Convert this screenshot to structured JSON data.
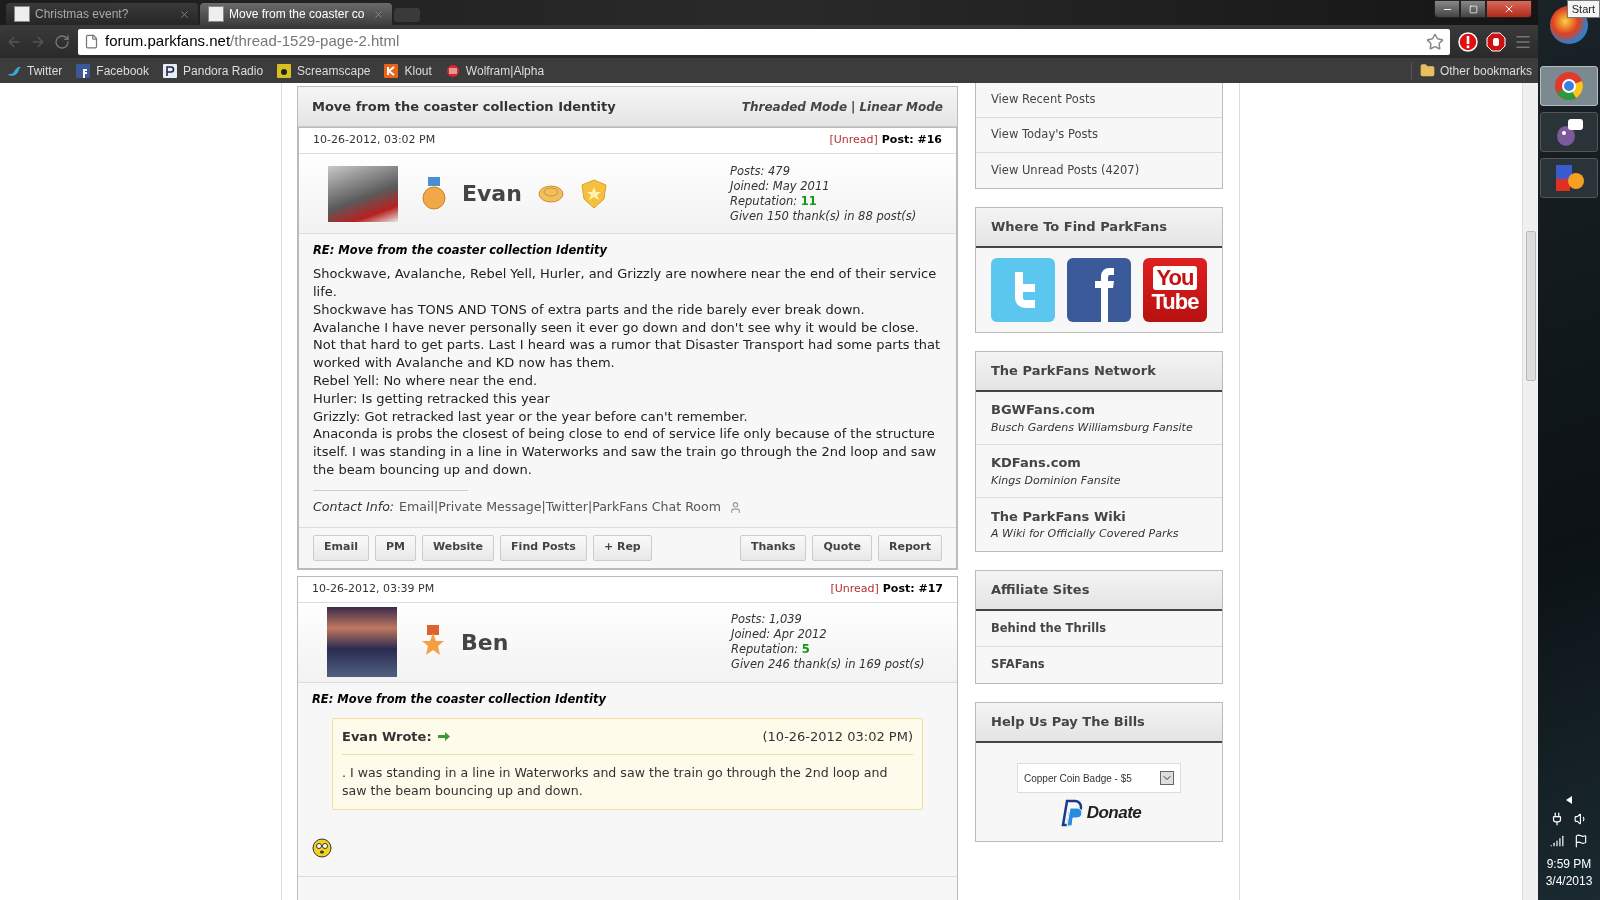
{
  "browser": {
    "tabs": [
      {
        "title": "Christmas event?",
        "selected": false
      },
      {
        "title": "Move from the coaster co",
        "selected": true
      }
    ],
    "url": {
      "domain": "forum.parkfans.net",
      "path": "/thread-1529-page-2.html"
    },
    "bookmarks": [
      {
        "label": "Twitter",
        "kind": "twitter"
      },
      {
        "label": "Facebook",
        "kind": "facebook"
      },
      {
        "label": "Pandora Radio",
        "kind": "pandora"
      },
      {
        "label": "Screamscape",
        "kind": "screamscape"
      },
      {
        "label": "Klout",
        "kind": "klout"
      },
      {
        "label": "Wolfram|Alpha",
        "kind": "wolfram"
      }
    ],
    "other_bookmarks": "Other bookmarks"
  },
  "thread": {
    "title": "Move from the coaster collection Identity",
    "modes": [
      "Threaded Mode",
      "Linear Mode"
    ],
    "modes_separator": "|"
  },
  "posts": [
    {
      "date": "10-26-2012, 03:02 PM",
      "unread": "[Unread]",
      "post_label": "Post:",
      "number": "#16",
      "username": "Evan",
      "avatar": {
        "kind": "coaster-train"
      },
      "rank_icon": {
        "kind": "medal"
      },
      "awards": [
        {
          "kind": "coin"
        },
        {
          "kind": "shield"
        }
      ],
      "stats": [
        {
          "label": "Posts:",
          "value": "479",
          "kind": "plain"
        },
        {
          "label": "Joined:",
          "value": "May 2011",
          "kind": "plain"
        },
        {
          "label": "Reputation:",
          "value": "11",
          "kind": "reputation"
        },
        {
          "label": "Given 150 thank(s) in 88 post(s)",
          "kind": "plain"
        }
      ],
      "subject": "RE: Move from the coaster collection Identity",
      "body": [
        "Shockwave, Avalanche, Rebel Yell, Hurler, and Grizzly are nowhere near the end of their service life.",
        "Shockwave has TONS AND TONS of extra parts and the ride barely ever break down.",
        "Avalanche I have never personally seen it ever go down and don't see why it would be close. Not that hard to get parts. Last I heard was a rumor that Disaster Transport had some parts that worked with Avalanche and KD now has them.",
        "Rebel Yell: No where near the end.",
        "Hurler: Is getting retracked this year",
        "Grizzly: Got retracked last year or the year before can't remember.",
        "Anaconda is probs the closest of being close to end of service life only because of the structure itself. I was standing in a line in Waterworks and saw the train go through the 2nd loop and saw the beam bouncing up and down."
      ],
      "contact": {
        "label": "Contact Info:",
        "separator": "|",
        "links": [
          "Email",
          "Private Message",
          "Twitter",
          "ParkFans Chat Room"
        ]
      },
      "buttons_left": [
        "Email",
        "PM",
        "Website",
        "Find Posts",
        "+ Rep"
      ],
      "buttons_right": [
        "Thanks",
        "Quote",
        "Report"
      ]
    },
    {
      "date": "10-26-2012, 03:39 PM",
      "unread": "[Unread]",
      "post_label": "Post:",
      "number": "#17",
      "username": "Ben",
      "avatar": {
        "kind": "night-scene"
      },
      "rank_icon": {
        "kind": "star-medal"
      },
      "stats": [
        {
          "label": "Posts:",
          "value": "1,039",
          "kind": "plain"
        },
        {
          "label": "Joined:",
          "value": "Apr 2012",
          "kind": "plain"
        },
        {
          "label": "Reputation:",
          "value": "5",
          "kind": "reputation"
        },
        {
          "label": "Given 246 thank(s) in 169 post(s)",
          "kind": "plain"
        }
      ],
      "subject": "RE: Move from the coaster collection Identity",
      "quote": {
        "author": "Evan Wrote:",
        "date": "(10-26-2012 03:02 PM)",
        "text": ". I was standing in a line in Waterworks and saw the train go through the 2nd loop and saw the beam bouncing up and down."
      },
      "smiley": true
    }
  ],
  "sidebar": {
    "quick_links": [
      "View Recent Posts",
      "View Today's Posts",
      "View Unread Posts (4207)"
    ],
    "find": {
      "title": "Where To Find ParkFans",
      "social": [
        {
          "kind": "twitter"
        },
        {
          "kind": "facebook"
        },
        {
          "kind": "youtube",
          "lines": [
            "You",
            "Tube"
          ]
        }
      ]
    },
    "network": {
      "title": "The ParkFans Network",
      "items": [
        {
          "name": "BGWFans.com",
          "desc": "Busch Gardens Williamsburg Fansite"
        },
        {
          "name": "KDFans.com",
          "desc": "Kings Dominion Fansite"
        },
        {
          "name": "The ParkFans Wiki",
          "desc": "A Wiki for Officially Covered Parks"
        }
      ]
    },
    "affiliates": {
      "title": "Affiliate Sites",
      "items": [
        "Behind the Thrills",
        "SFAFans"
      ]
    },
    "bills": {
      "title": "Help Us Pay The Bills",
      "select": "Copper Coin Badge - $5",
      "donate": "Donate"
    }
  },
  "taskbar": {
    "tooltip": "Start",
    "apps": [
      {
        "kind": "chrome",
        "selected": true
      },
      {
        "kind": "pidgin",
        "selected": false
      },
      {
        "kind": "mirc",
        "selected": false
      }
    ],
    "time": "9:59 PM",
    "date": "3/4/2013"
  }
}
